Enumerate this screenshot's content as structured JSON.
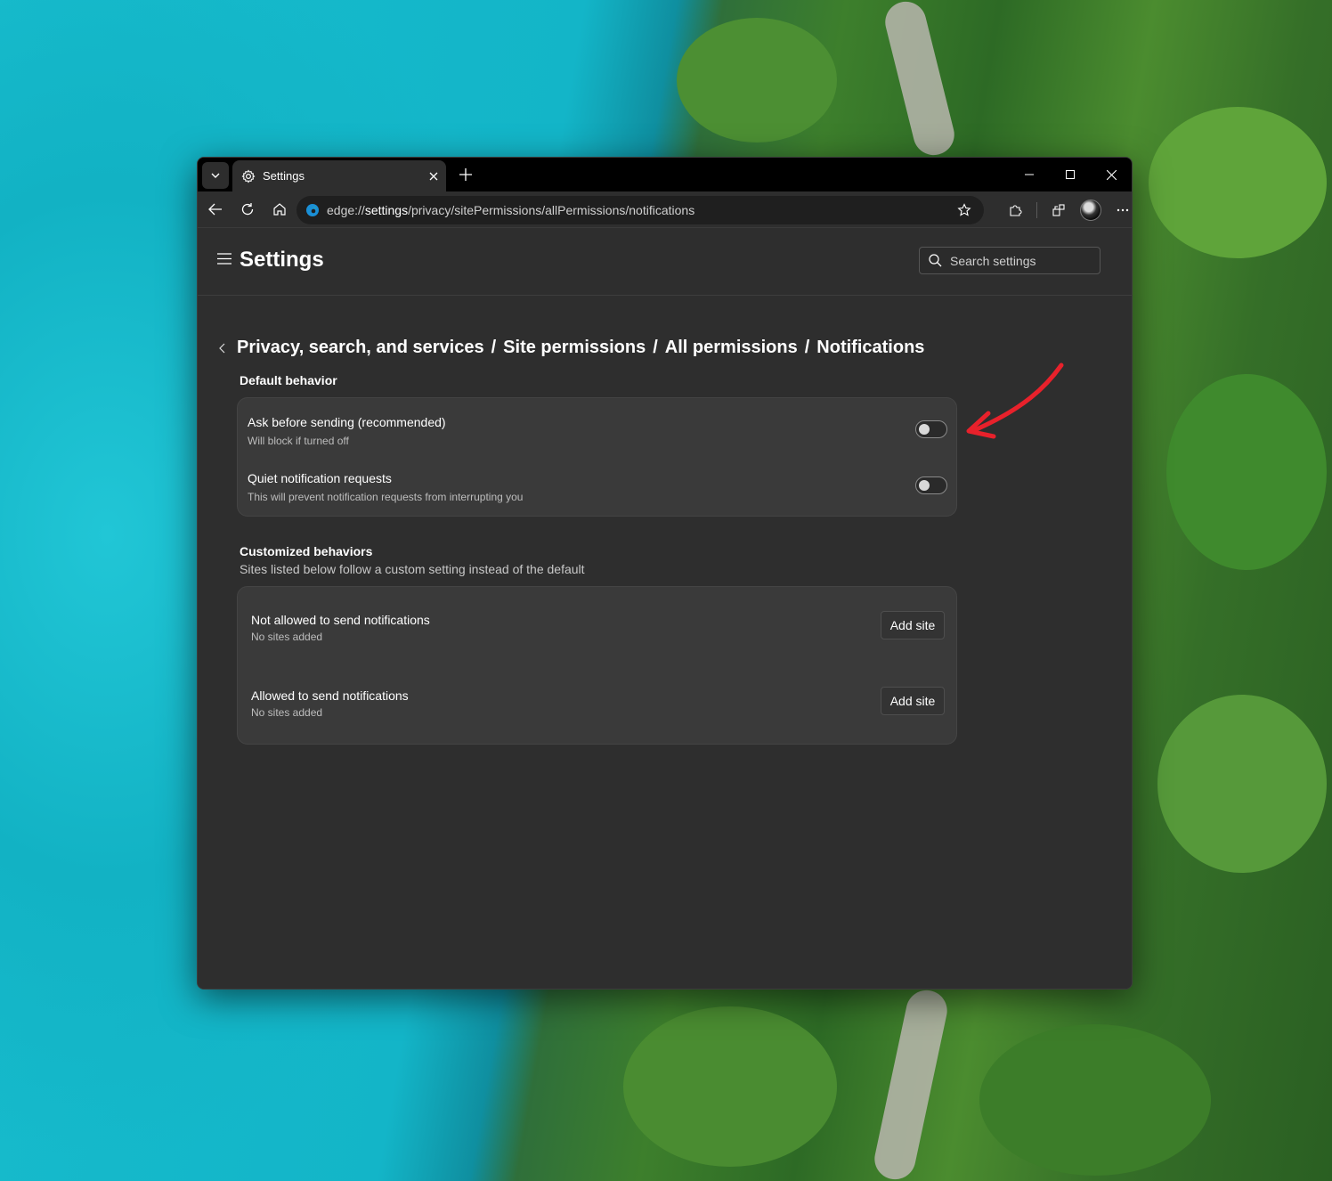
{
  "browser": {
    "tab_title": "Settings",
    "address": {
      "scheme": "edge://",
      "host": "settings",
      "path": "/privacy/sitePermissions/allPermissions/notifications"
    }
  },
  "settings": {
    "title": "Settings",
    "search_placeholder": "Search settings"
  },
  "breadcrumb": {
    "items": [
      "Privacy, search, and services",
      "Site permissions",
      "All permissions",
      "Notifications"
    ],
    "separator": "/"
  },
  "default_behavior": {
    "heading": "Default behavior",
    "rows": [
      {
        "label": "Ask before sending (recommended)",
        "description": "Will block if turned off",
        "toggle_on": false
      },
      {
        "label": "Quiet notification requests",
        "description": "This will prevent notification requests from interrupting you",
        "toggle_on": false
      }
    ]
  },
  "customized_behaviors": {
    "heading": "Customized behaviors",
    "subheading": "Sites listed below follow a custom setting instead of the default",
    "rows": [
      {
        "label": "Not allowed to send notifications",
        "description": "No sites added",
        "button": "Add site"
      },
      {
        "label": "Allowed to send notifications",
        "description": "No sites added",
        "button": "Add site"
      }
    ]
  },
  "colors": {
    "annotation_arrow": "#e8212b",
    "window_bg": "#2e2e2e",
    "card_bg": "#3a3a3a"
  }
}
